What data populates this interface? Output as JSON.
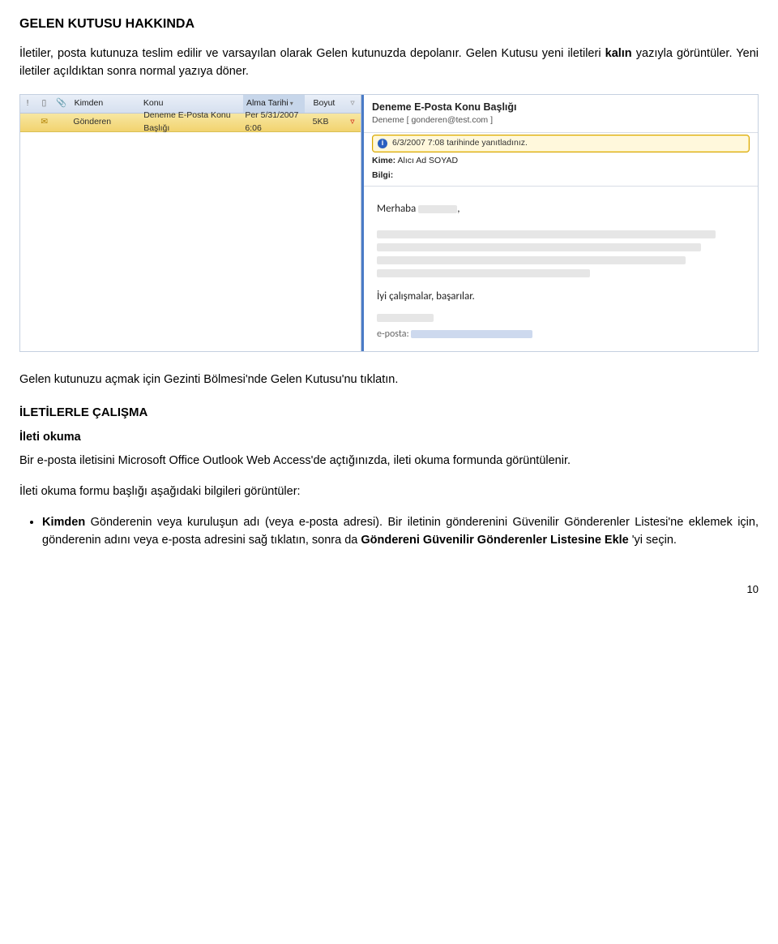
{
  "title": "GELEN KUTUSU HAKKINDA",
  "intro": {
    "p1_prefix": "İletiler, posta kutunuza teslim edilir ve varsayılan olarak Gelen kutunuzda depolanır. Gelen Kutusu yeni iletileri ",
    "p1_bold": "kalın",
    "p1_suffix": " yazıyla görüntüler. Yeni iletiler açıldıktan sonra normal yazıya döner."
  },
  "shot": {
    "headers": {
      "kimden": "Kimden",
      "konu": "Konu",
      "alma": "Alma Tarihi",
      "boyut": "Boyut"
    },
    "row": {
      "sender": "Gönderen",
      "subject": "Deneme E-Posta Konu Başlığı",
      "date": "Per 5/31/2007 6:06",
      "size": "5KB"
    },
    "preview": {
      "subject": "Deneme E-Posta Konu Başlığı",
      "from": "Deneme [ gonderen@test.com ]",
      "replied": "6/3/2007 7:08 tarihinde yanıtladınız.",
      "kime_label": "Kime:",
      "kime_value": "Alıcı Ad SOYAD",
      "bilgi_label": "Bilgi:",
      "greeting": "Merhaba",
      "signoff": "İyi çalışmalar, başarılar.",
      "sig_eposta": "e-posta:"
    }
  },
  "open_hint": "Gelen kutunuzu açmak için Gezinti Bölmesi'nde Gelen Kutusu'nu tıklatın.",
  "sect": {
    "h": "İLETİLERLE ÇALIŞMA",
    "sub": "İleti okuma",
    "body1": "Bir e-posta iletisini Microsoft Office Outlook Web Access'de açtığınızda, ileti okuma formunda görüntülenir.",
    "body2": "İleti okuma formu başlığı aşağıdaki bilgileri görüntüler:",
    "bullet": {
      "kimden_label": "Kimden",
      "line1_rest": "   Gönderenin veya kuruluşun adı (veya e-posta adresi).",
      "line2_prefix": "Bir iletinin gönderenini Güvenilir Gönderenler Listesi'ne eklemek için, gönderenin adını veya e-posta adresini sağ tıklatın, sonra da ",
      "line2_bold": "Göndereni Güvenilir Gönderenler Listesine Ekle",
      "line2_suffix": "'yi seçin."
    }
  },
  "pagenum": "10"
}
